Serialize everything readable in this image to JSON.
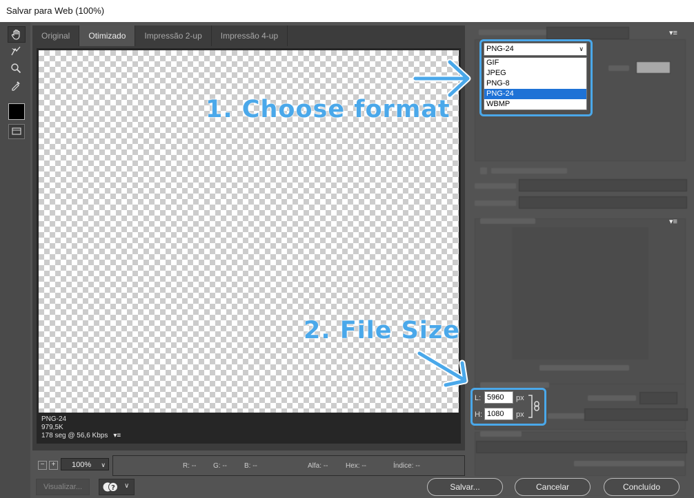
{
  "window": {
    "title": "Salvar para Web (100%)"
  },
  "tabs": [
    {
      "label": "Original",
      "active": false
    },
    {
      "label": "Otimizado",
      "active": true
    },
    {
      "label": "Impressão 2-up",
      "active": false
    },
    {
      "label": "Impressão 4-up",
      "active": false
    }
  ],
  "tools": [
    "hand-tool-icon",
    "slice-select-tool-icon",
    "zoom-tool-icon",
    "eyedropper-tool-icon"
  ],
  "preview_info": {
    "format": "PNG-24",
    "size": "979,5K",
    "time": "178 seg @ 56,6 Kbps"
  },
  "status": {
    "zoom": "100%",
    "r": "R: --",
    "g": "G: --",
    "b": "B: --",
    "alpha": "Alfa: --",
    "hex": "Hex: --",
    "index": "Índice: --"
  },
  "format_dropdown": {
    "selected": "PNG-24",
    "options": [
      {
        "label": "GIF",
        "selected": false
      },
      {
        "label": "JPEG",
        "selected": false
      },
      {
        "label": "PNG-8",
        "selected": false
      },
      {
        "label": "PNG-24",
        "selected": true
      },
      {
        "label": "WBMP",
        "selected": false
      }
    ]
  },
  "annotations": {
    "step1": "1. Choose format",
    "step2": "2. File Size"
  },
  "image_size": {
    "width_label": "L:",
    "width": "5960",
    "height_label": "H:",
    "height": "1080",
    "unit": "px"
  },
  "buttons": {
    "preview": "Visualizar...",
    "save": "Salvar...",
    "cancel": "Cancelar",
    "done": "Concluído"
  },
  "colors": {
    "accent": "#4aa8ea",
    "selected_option": "#1e72d6"
  }
}
